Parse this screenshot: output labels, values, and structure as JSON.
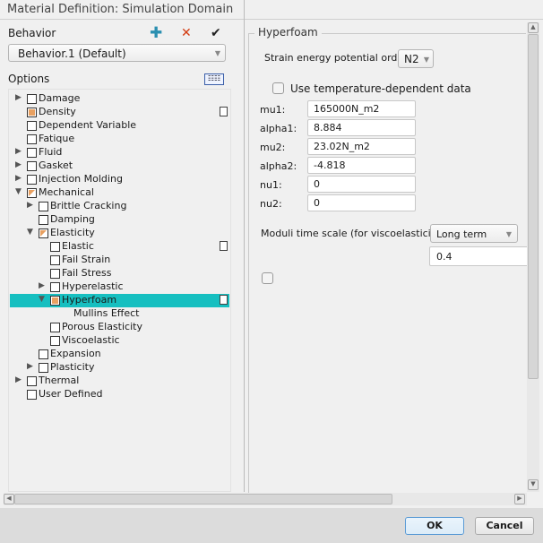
{
  "window": {
    "title": "Material Definition: Simulation Domain"
  },
  "behavior": {
    "label": "Behavior",
    "selected": "Behavior.1 (Default)",
    "add_icon": "plus-icon",
    "delete_icon": "x-icon",
    "apply_icon": "check-icon"
  },
  "options": {
    "label": "Options",
    "tree": [
      {
        "label": "Damage",
        "level": 0,
        "expander": "collapsed",
        "check": "none",
        "doc": false
      },
      {
        "label": "Density",
        "level": 0,
        "expander": "",
        "check": "full",
        "doc": true
      },
      {
        "label": "Dependent Variable",
        "level": 0,
        "expander": "",
        "check": "none",
        "doc": false
      },
      {
        "label": "Fatique",
        "level": 0,
        "expander": "",
        "check": "none",
        "doc": false
      },
      {
        "label": "Fluid",
        "level": 0,
        "expander": "collapsed",
        "check": "none",
        "doc": false
      },
      {
        "label": "Gasket",
        "level": 0,
        "expander": "collapsed",
        "check": "none",
        "doc": false
      },
      {
        "label": "Injection Molding",
        "level": 0,
        "expander": "collapsed",
        "check": "none",
        "doc": false
      },
      {
        "label": "Mechanical",
        "level": 0,
        "expander": "expanded",
        "check": "part",
        "doc": false
      },
      {
        "label": "Brittle Cracking",
        "level": 1,
        "expander": "collapsed",
        "check": "none",
        "doc": false
      },
      {
        "label": "Damping",
        "level": 1,
        "expander": "",
        "check": "none",
        "doc": false
      },
      {
        "label": "Elasticity",
        "level": 1,
        "expander": "expanded",
        "check": "part",
        "doc": false
      },
      {
        "label": "Elastic",
        "level": 2,
        "expander": "",
        "check": "none",
        "doc": true
      },
      {
        "label": "Fail Strain",
        "level": 2,
        "expander": "",
        "check": "none",
        "doc": false
      },
      {
        "label": "Fail Stress",
        "level": 2,
        "expander": "",
        "check": "none",
        "doc": false
      },
      {
        "label": "Hyperelastic",
        "level": 2,
        "expander": "collapsed",
        "check": "none",
        "doc": false
      },
      {
        "label": "Hyperfoam",
        "level": 2,
        "expander": "expanded",
        "check": "full",
        "doc": true,
        "selected": true
      },
      {
        "label": "Mullins Effect",
        "level": 3,
        "expander": "",
        "check": "hidden",
        "doc": false
      },
      {
        "label": "Porous Elasticity",
        "level": 2,
        "expander": "",
        "check": "none",
        "doc": false
      },
      {
        "label": "Viscoelastic",
        "level": 2,
        "expander": "",
        "check": "none",
        "doc": false
      },
      {
        "label": "Expansion",
        "level": 1,
        "expander": "",
        "check": "none",
        "doc": false
      },
      {
        "label": "Plasticity",
        "level": 1,
        "expander": "collapsed",
        "check": "none",
        "doc": false
      },
      {
        "label": "Thermal",
        "level": 0,
        "expander": "collapsed",
        "check": "none",
        "doc": false
      },
      {
        "label": "User Defined",
        "level": 0,
        "expander": "",
        "check": "none",
        "doc": false
      }
    ]
  },
  "hyperfoam": {
    "group_title": "Hyperfoam",
    "order_label": "Strain energy potential order:",
    "order_value": "N2",
    "temp_dep_label": "Use temperature-dependent data",
    "params": [
      {
        "label": "mu1:",
        "value": "165000N_m2"
      },
      {
        "label": "alpha1:",
        "value": "8.884"
      },
      {
        "label": "mu2:",
        "value": "23.02N_m2"
      },
      {
        "label": "alpha2:",
        "value": "-4.818"
      },
      {
        "label": "nu1:",
        "value": "0"
      },
      {
        "label": "nu2:",
        "value": "0"
      }
    ],
    "moduli_label": "Moduli time scale (for viscoelasticity):",
    "moduli_value": "Long term",
    "extra_value": "0.4"
  },
  "footer": {
    "ok": "OK",
    "cancel": "Cancel"
  }
}
